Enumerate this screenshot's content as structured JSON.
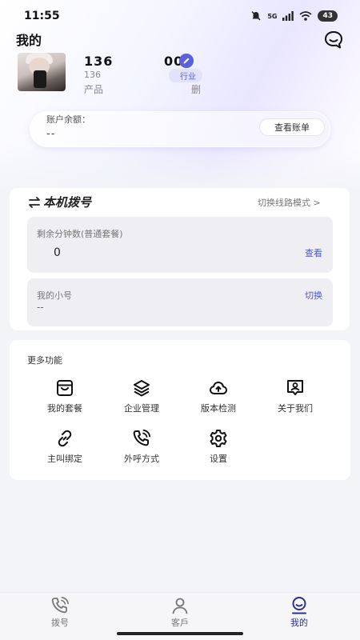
{
  "status_bar": {
    "time": "11:55",
    "network": "5G",
    "battery": "43"
  },
  "header": {
    "title": "我的"
  },
  "profile": {
    "phone_prefix": "136",
    "phone_suffix": "00",
    "sub_line": "136",
    "industry_tag": "行业",
    "product_prefix": "产品",
    "product_suffix": "删"
  },
  "balance": {
    "label": "账户余额：",
    "value": "--",
    "button_label": "查看账单"
  },
  "dial": {
    "title": "本机拨号",
    "switch_mode": "切换线路模式 >",
    "minutes_label": "剩余分钟数(普通套餐)",
    "minutes_value": "0",
    "minutes_action": "查看",
    "subnumber_label": "我的小号",
    "subnumber_value": "--",
    "subnumber_action": "切换"
  },
  "more": {
    "title": "更多功能",
    "items": [
      {
        "label": "我的套餐",
        "icon": "bag-icon"
      },
      {
        "label": "企业管理",
        "icon": "layers-icon"
      },
      {
        "label": "版本检测",
        "icon": "cloud-upload-icon"
      },
      {
        "label": "关于我们",
        "icon": "about-icon"
      },
      {
        "label": "主叫绑定",
        "icon": "link-icon"
      },
      {
        "label": "外呼方式",
        "icon": "phone-call-icon"
      },
      {
        "label": "设置",
        "icon": "gear-icon"
      }
    ]
  },
  "tabbar": {
    "items": [
      {
        "label": "拨号",
        "icon": "phone-call-icon",
        "active": false
      },
      {
        "label": "客戶",
        "icon": "person-icon",
        "active": false
      },
      {
        "label": "我的",
        "icon": "profile-icon",
        "active": true
      }
    ]
  },
  "colors": {
    "accent": "#4d57c7",
    "active_tab": "#2b2f8f"
  }
}
